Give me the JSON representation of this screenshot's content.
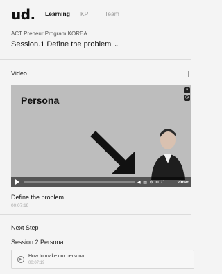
{
  "header": {
    "logo": "ud.",
    "tabs": [
      {
        "label": "Learning",
        "active": true
      },
      {
        "label": "KPI",
        "active": false
      },
      {
        "label": "Team",
        "active": false
      }
    ]
  },
  "program": {
    "name": "ACT Preneur Program KOREA",
    "session": "Session.1 Define the problem"
  },
  "video_section": {
    "heading": "Video",
    "video_title_overlay": "Persona",
    "player_brand": "vimeo",
    "name": "Define the problem",
    "duration": "00:07:19"
  },
  "next_step": {
    "heading": "Next Step",
    "session": "Session.2 Persona",
    "items": [
      {
        "title": "How to make our persona",
        "duration": "00:07:19"
      }
    ]
  },
  "colors": {
    "background": "#f4f4f4",
    "video_bg": "#bdbdbd",
    "text": "#111111"
  }
}
